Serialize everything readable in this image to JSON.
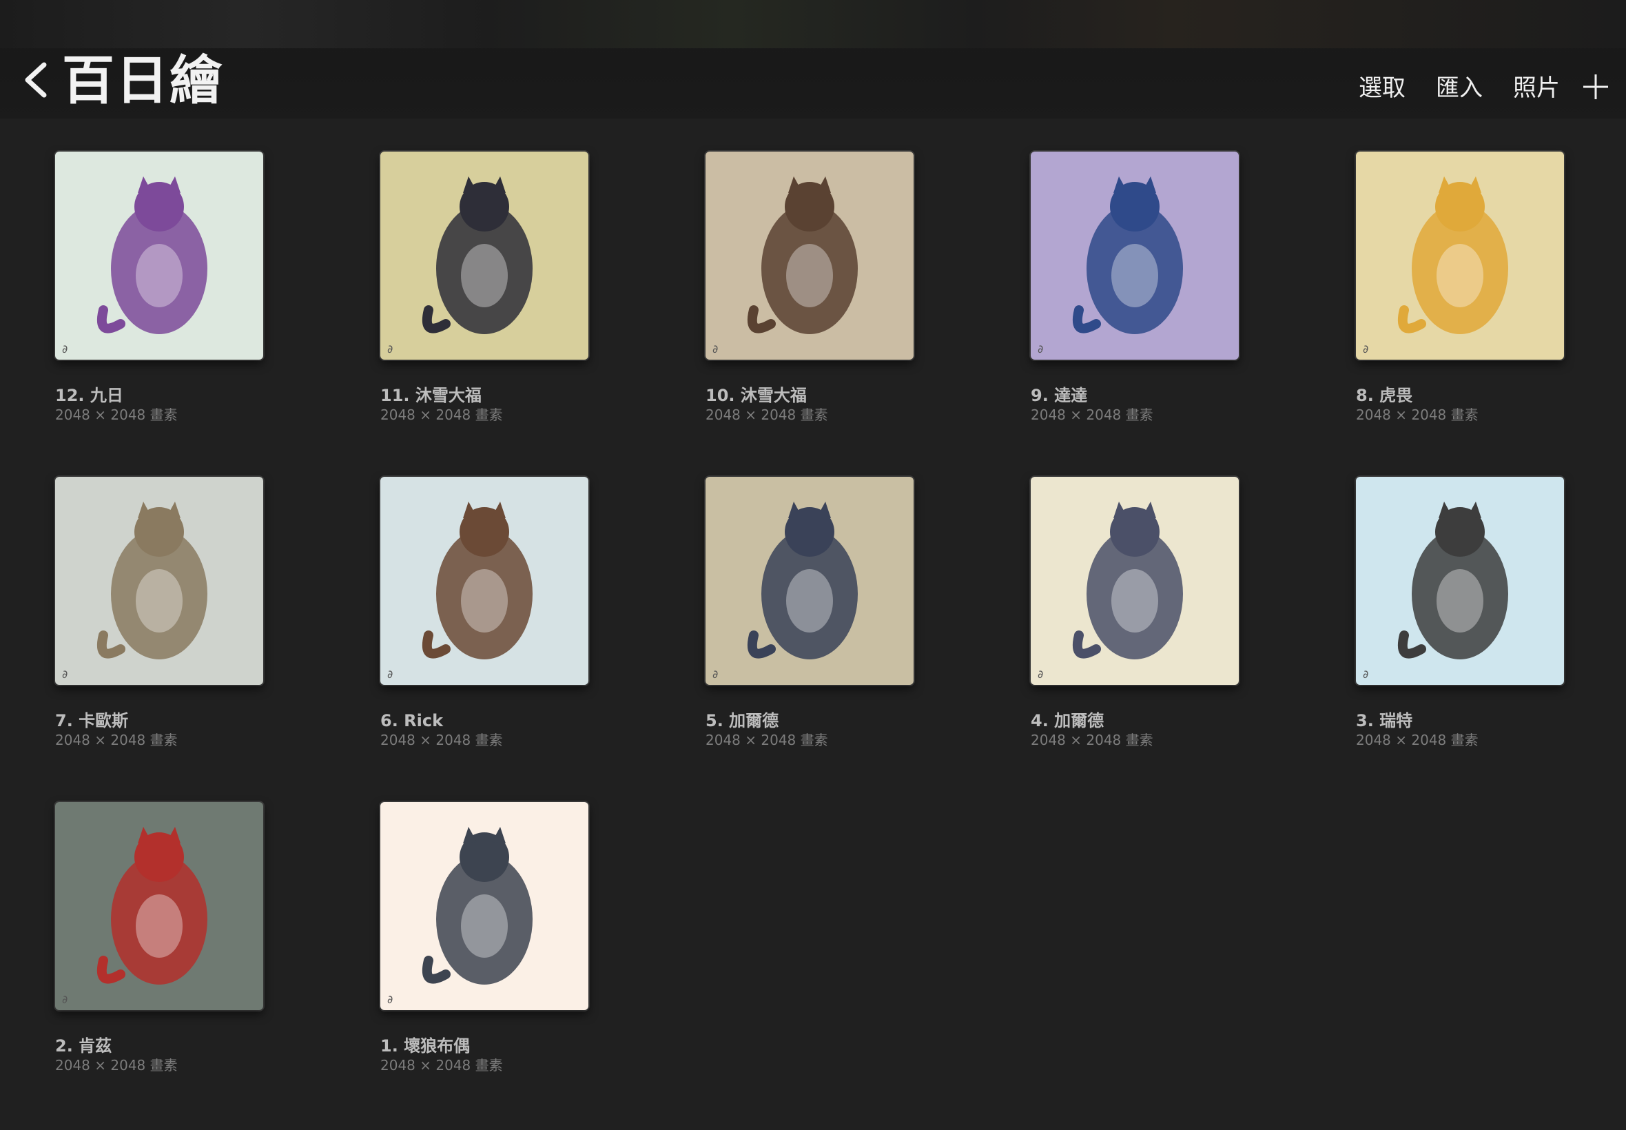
{
  "header": {
    "title": "百日繪",
    "actions": {
      "select": "選取",
      "import": "匯入",
      "photos": "照片"
    }
  },
  "icons": {
    "back": "chevron-left-icon",
    "add": "plus-icon"
  },
  "artworks": [
    {
      "title": "12. 九日",
      "size": "2048 × 2048 畫素",
      "bg": "#dde8df",
      "accent": "#7d4a9a"
    },
    {
      "title": "11. 沐雪大福",
      "size": "2048 × 2048 畫素",
      "bg": "#d7cf9c",
      "accent": "#2e2e38"
    },
    {
      "title": "10. 沐雪大福",
      "size": "2048 × 2048 畫素",
      "bg": "#cbbda4",
      "accent": "#5a4232"
    },
    {
      "title": "9. 達達",
      "size": "2048 × 2048 畫素",
      "bg": "#b3a6d1",
      "accent": "#2f4a8a"
    },
    {
      "title": "8. 虎畏",
      "size": "2048 × 2048 畫素",
      "bg": "#e6d8a6",
      "accent": "#e0a93a"
    },
    {
      "title": "7. 卡歐斯",
      "size": "2048 × 2048 畫素",
      "bg": "#cfd3cd",
      "accent": "#8a7a60"
    },
    {
      "title": "6. Rick",
      "size": "2048 × 2048 畫素",
      "bg": "#d6e2e4",
      "accent": "#6b4a36"
    },
    {
      "title": "5. 加爾德",
      "size": "2048 × 2048 畫素",
      "bg": "#c9bfa3",
      "accent": "#3a4258"
    },
    {
      "title": "4. 加爾德",
      "size": "2048 × 2048 畫素",
      "bg": "#ece6cf",
      "accent": "#4b5068"
    },
    {
      "title": "3. 瑞特",
      "size": "2048 × 2048 畫素",
      "bg": "#cfe6ee",
      "accent": "#3d3d3d"
    },
    {
      "title": "2. 肯茲",
      "size": "2048 × 2048 畫素",
      "bg": "#6f7a72",
      "accent": "#b3302c"
    },
    {
      "title": "1. 壞狼布偶",
      "size": "2048 × 2048 畫素",
      "bg": "#fbf0e6",
      "accent": "#3d4450"
    }
  ]
}
